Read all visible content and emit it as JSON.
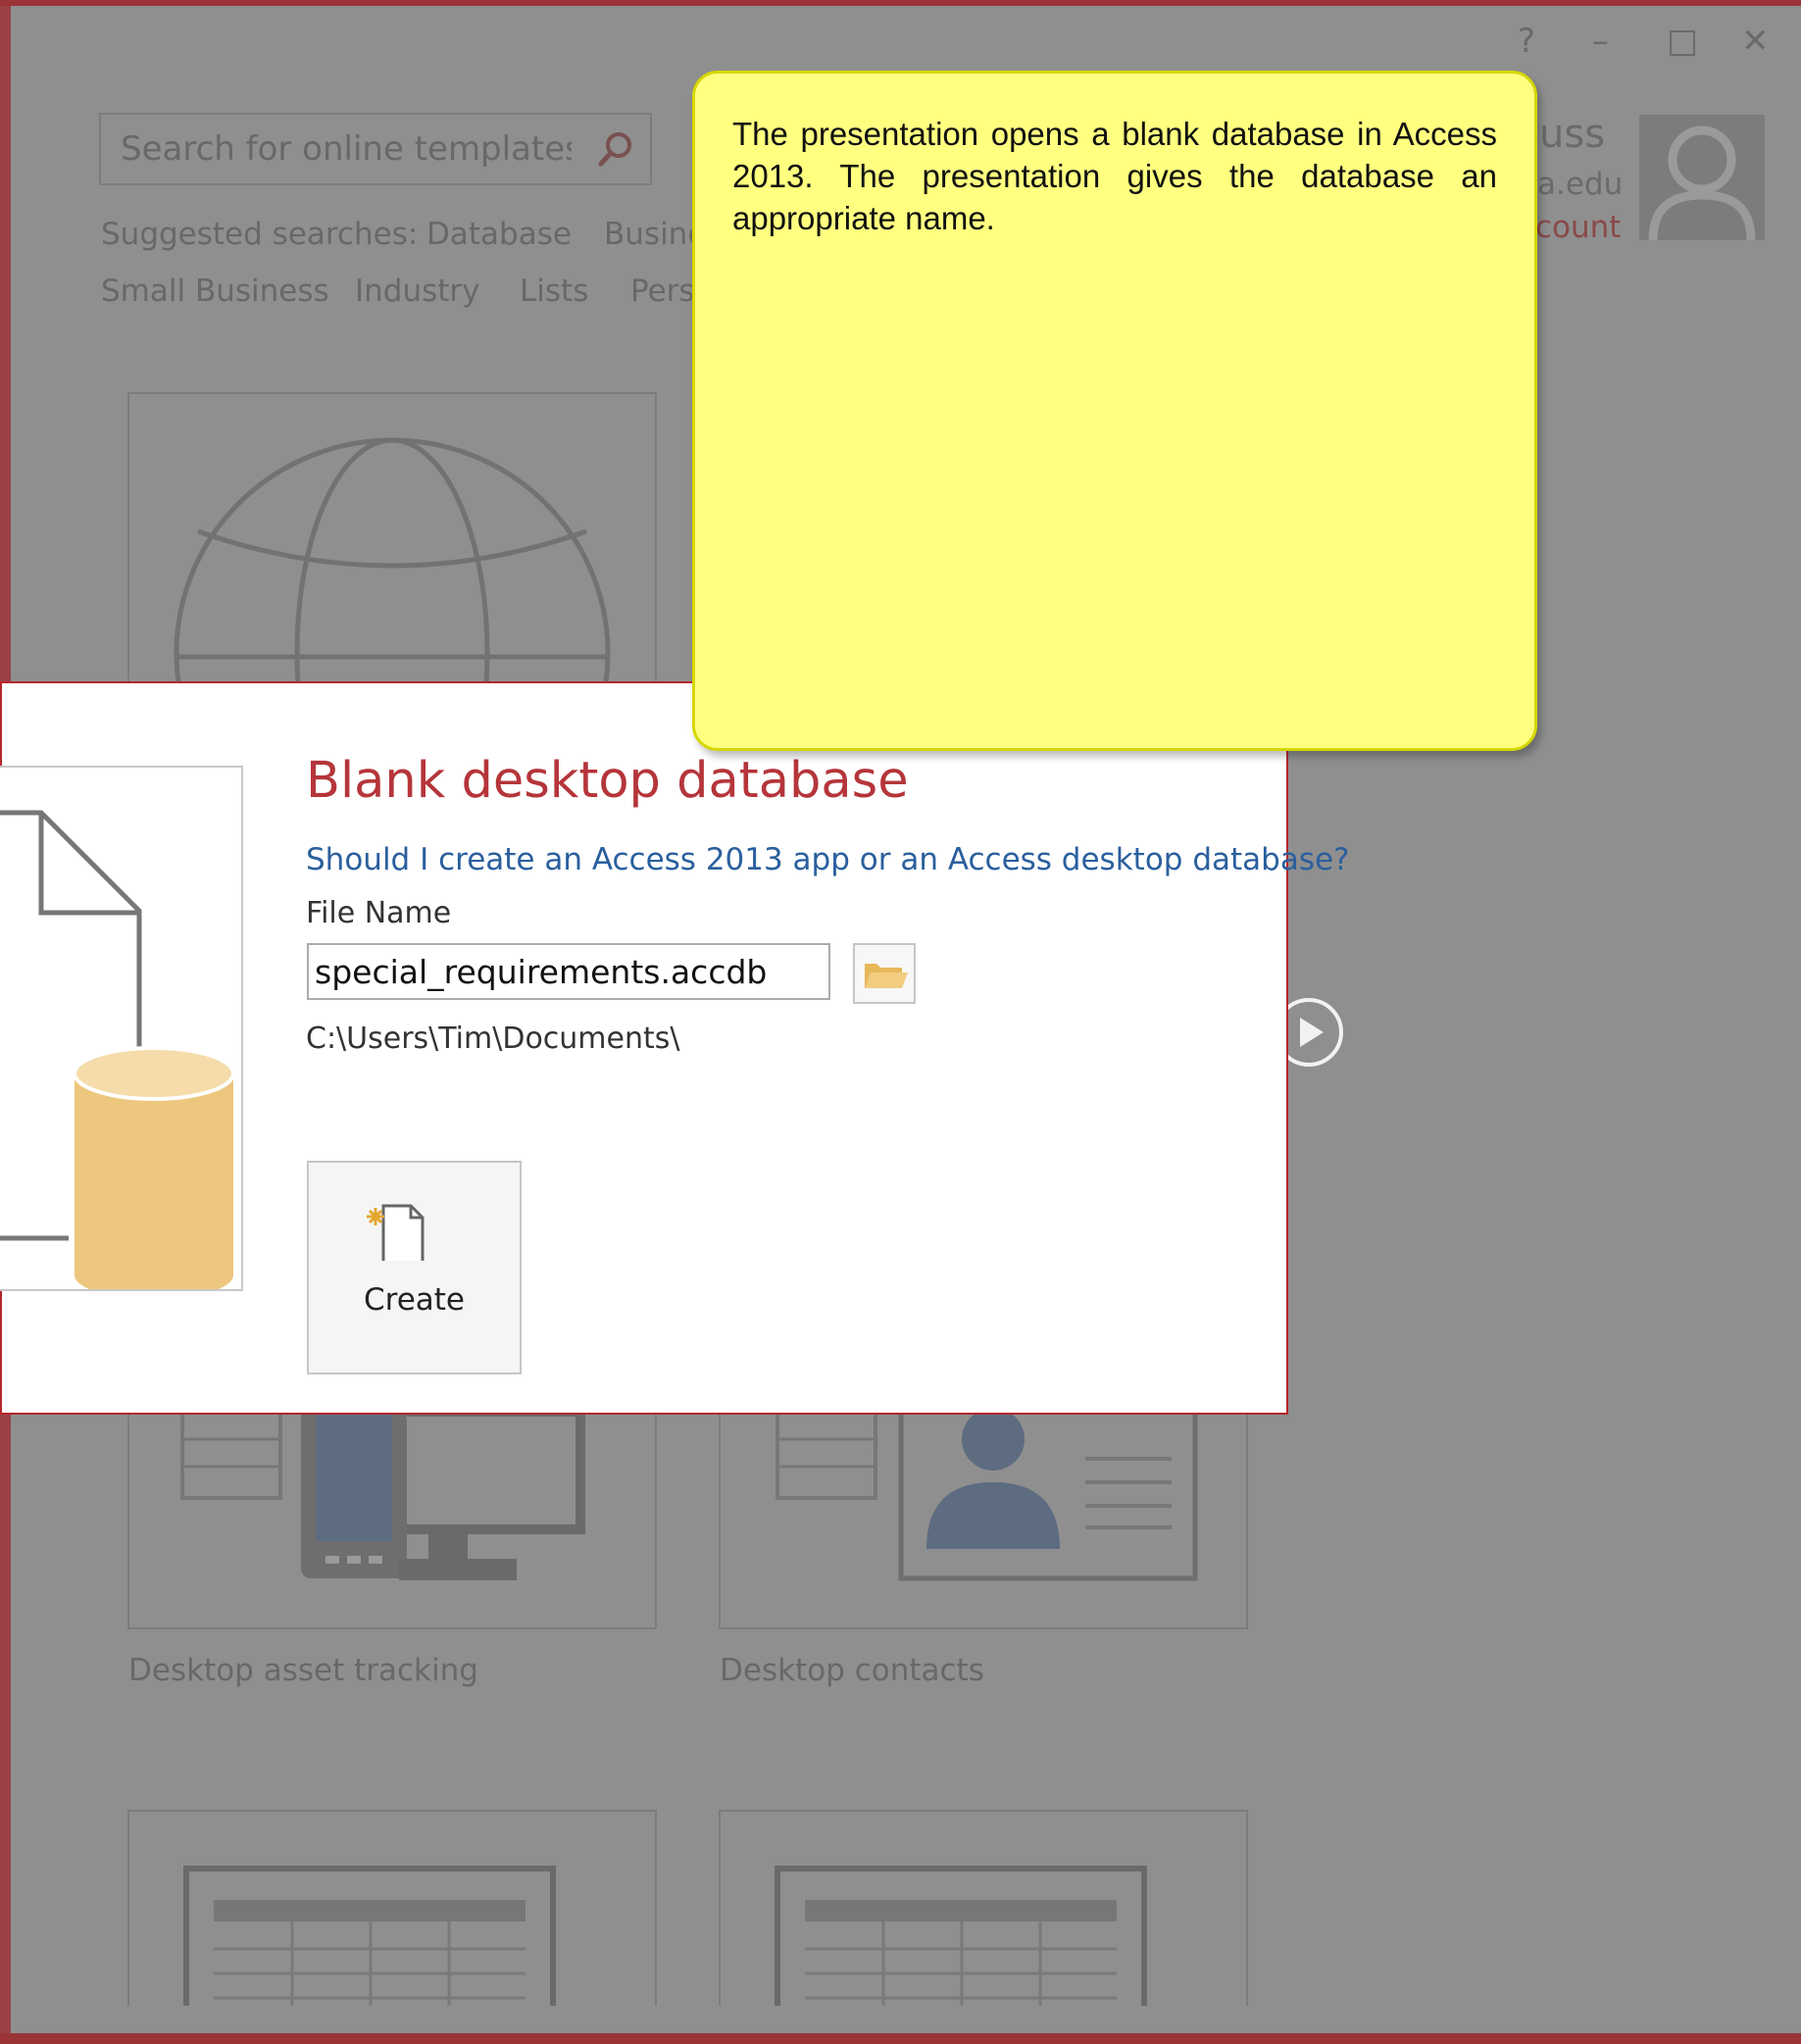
{
  "window": {
    "help_glyph": "?",
    "minimize_glyph": "–",
    "maximize_glyph": "□",
    "close_glyph": "✕"
  },
  "search": {
    "placeholder": "Search for online templates"
  },
  "suggested": {
    "label": "Suggested searches:",
    "items": [
      "Database",
      "Busine",
      "Small Business",
      "Industry",
      "Lists",
      "Pers"
    ]
  },
  "account": {
    "name_partial": "uss",
    "email_partial": "a.edu",
    "link_partial": "count"
  },
  "templates": [
    {
      "label": "Desktop asset tracking"
    },
    {
      "label": "Desktop contacts"
    }
  ],
  "dialog": {
    "title": "Blank desktop database",
    "help_link": "Should I create an Access 2013 app or an Access desktop database?",
    "file_name_label": "File Name",
    "file_name_value": "special_requirements.accdb",
    "path": "C:\\Users\\Tim\\Documents\\",
    "create_label": "Create"
  },
  "note": {
    "text": "The presentation opens a blank database in Access 2013. The presentation gives the database an appropriate name."
  },
  "colors": {
    "accent": "#b5353a",
    "link": "#2a5f9e",
    "note_bg": "#ffff80",
    "overlay": "#8f8f8f"
  }
}
